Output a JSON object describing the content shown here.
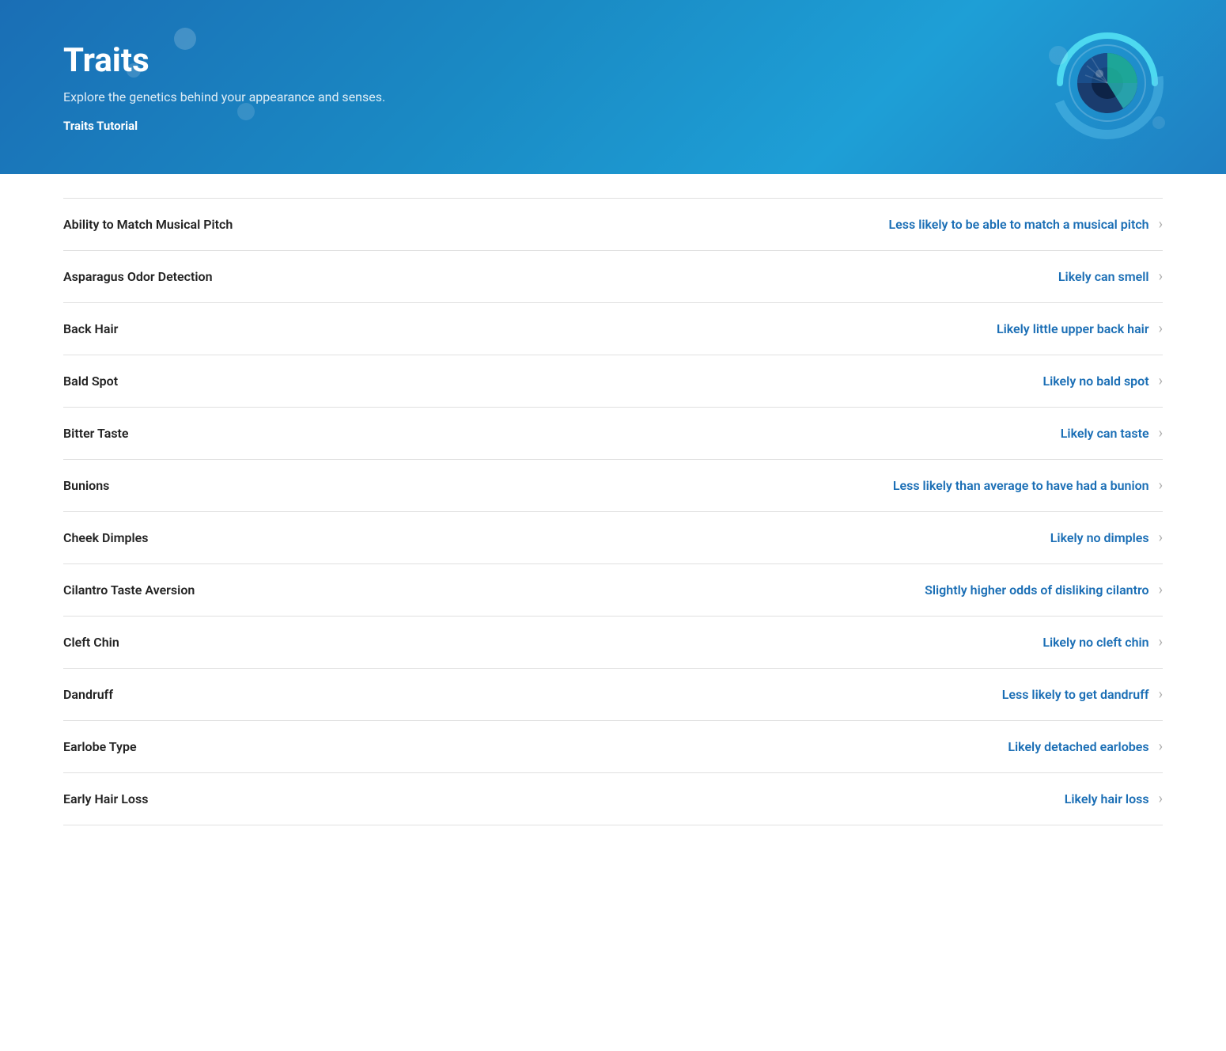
{
  "header": {
    "title": "Traits",
    "subtitle": "Explore the genetics behind your appearance and senses.",
    "tutorial_label": "Traits Tutorial"
  },
  "traits": [
    {
      "name": "Ability to Match Musical Pitch",
      "result": "Less likely to be able to match a musical pitch"
    },
    {
      "name": "Asparagus Odor Detection",
      "result": "Likely can smell"
    },
    {
      "name": "Back Hair",
      "result": "Likely little upper back hair"
    },
    {
      "name": "Bald Spot",
      "result": "Likely no bald spot"
    },
    {
      "name": "Bitter Taste",
      "result": "Likely can taste"
    },
    {
      "name": "Bunions",
      "result": "Less likely than average to have had a bunion"
    },
    {
      "name": "Cheek Dimples",
      "result": "Likely no dimples"
    },
    {
      "name": "Cilantro Taste Aversion",
      "result": "Slightly higher odds of disliking cilantro"
    },
    {
      "name": "Cleft Chin",
      "result": "Likely no cleft chin"
    },
    {
      "name": "Dandruff",
      "result": "Less likely to get dandruff"
    },
    {
      "name": "Earlobe Type",
      "result": "Likely detached earlobes"
    },
    {
      "name": "Early Hair Loss",
      "result": "Likely hair loss"
    }
  ]
}
